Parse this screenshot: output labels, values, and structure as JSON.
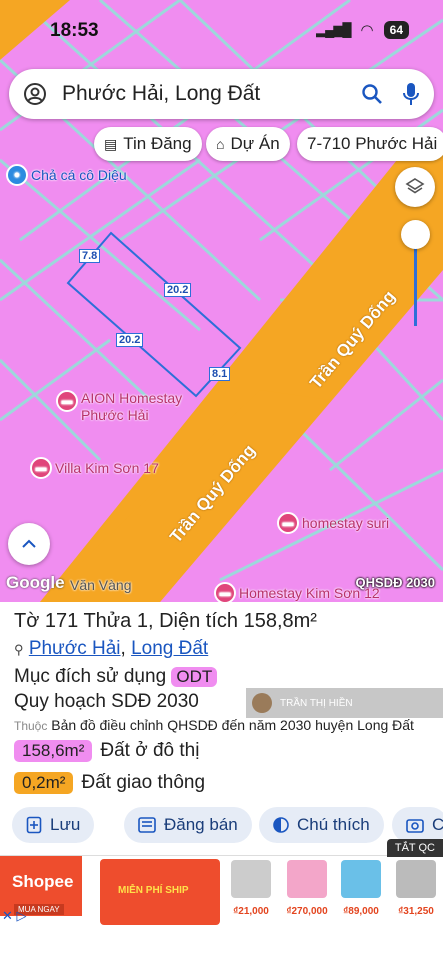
{
  "status_bar": {
    "time": "18:53",
    "battery": "64"
  },
  "search": {
    "query": "Phước Hải, Long Đất"
  },
  "chips": {
    "listing": "Tin Đăng",
    "project": "Dự Án",
    "address": "7-710 Phước Hải"
  },
  "map": {
    "poi_top": "Chả cá cô Diệu",
    "poi_aion_1": "AION Homestay",
    "poi_aion_2": "Phước Hải",
    "poi_villa": "Villa Kim Sơn 17",
    "poi_suri": "homestay suri",
    "poi_kimson": "Homestay Kim Sơn 12",
    "street_van_vang": "Văn Vàng",
    "road_1": "Trần Quý Dống",
    "road_2": "Trần Quý Dống",
    "google": "Google",
    "layer_label": "QHSDĐ 2030",
    "dims": {
      "top_left": "7.8",
      "top_right": "20.2",
      "left": "20.2",
      "right": "8.1"
    }
  },
  "parcel": {
    "title": "Tờ 171 Thửa 1, Diện tích 158,8m²",
    "ward": "Phước Hải",
    "separator": ",",
    "district": "Long Đất",
    "purpose_label": "Mục đích sử dụng",
    "purpose_code": "ODT",
    "plan_label": "Quy hoạch SDĐ 2030",
    "source_prefix": "Thuộc",
    "source_text": "Bản đồ điều chỉnh QHSDĐ đến năm 2030 huyện Long Đất",
    "watermark": "TRẦN THỊ HIỀN",
    "land_1_area": "158,6m²",
    "land_1_label": "Đất ở đô thị",
    "land_2_area": "0,2m²",
    "land_2_label": "Đất giao thông"
  },
  "actions": {
    "save": "Lưu",
    "post": "Đăng bán",
    "note": "Chú thích",
    "capture": "C"
  },
  "ad": {
    "close": "TẮT QC",
    "brand": "Shopee",
    "cta": "MUA NGAY",
    "promo": "MIỄN PHÍ SHIP",
    "prices": [
      "₫21,000",
      "₫270,000",
      "₫89,000",
      "₫31,250"
    ]
  },
  "colors": {
    "map_pink": "#f08df0",
    "road_orange": "#f5a623",
    "link_blue": "#1a56c0"
  }
}
